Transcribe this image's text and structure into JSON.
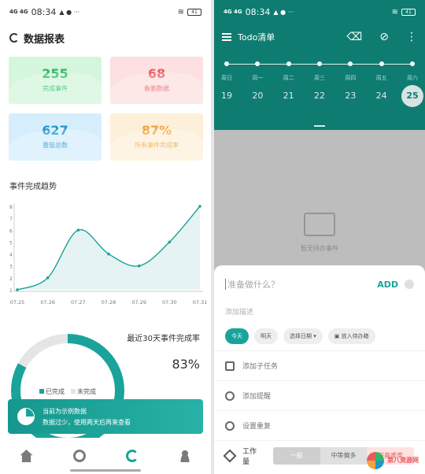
{
  "status_left": {
    "time": "08:34",
    "signal": "4G 4G",
    "extra": "▲ ● ···",
    "battery": "41"
  },
  "status_right": {
    "time": "08:34",
    "signal": "4G 4G",
    "extra": "▲ ● ···",
    "battery": "41"
  },
  "report": {
    "title": "数据报表",
    "stats": [
      {
        "value": "255",
        "label": "完成事件"
      },
      {
        "value": "68",
        "label": "备删数据"
      },
      {
        "value": "627",
        "label": "番茄总数"
      },
      {
        "value": "87%",
        "label": "所有事件完成率"
      }
    ],
    "trend_title": "事件完成趋势",
    "rate_title": "最近30天事件完成率",
    "rate_value": "83%",
    "legend": [
      "已完成",
      "未完成"
    ],
    "toast_line1": "当前为示例数据",
    "toast_line2": "数据过少，使用两天后再来查看"
  },
  "chart_data": {
    "type": "line",
    "categories": [
      "07.25",
      "07.26",
      "07.27",
      "07.28",
      "07.29",
      "07.30",
      "07.31"
    ],
    "values": [
      1,
      2,
      6,
      4,
      3,
      5,
      8
    ],
    "ylim": [
      1,
      8
    ],
    "yticks": [
      "1",
      "2",
      "3",
      "4",
      "5",
      "6",
      "7",
      "8"
    ],
    "color": "#1aa39a",
    "fill": "#e5f3f4",
    "grid": false
  },
  "nav": [
    "home-icon",
    "timer-icon",
    "stats-icon",
    "user-icon"
  ],
  "todo": {
    "title": "Todo清单",
    "weekdays": [
      "周日",
      "周一",
      "周二",
      "周三",
      "周四",
      "周五",
      "周六"
    ],
    "days": [
      "19",
      "20",
      "21",
      "22",
      "23",
      "24",
      "25"
    ],
    "selected_day": "25",
    "empty_text": "暂无待办事件",
    "input_placeholder": "准备做什么？",
    "add_label": "ADD",
    "desc_placeholder": "添加描述",
    "chips": [
      "今天",
      "明天",
      "选择日期",
      "放入待办箱"
    ],
    "options": [
      "添加子任务",
      "添加提醒",
      "设置重复"
    ],
    "workload_label": "工作量",
    "workload_options": [
      "一般",
      "中等偏多",
      "较高难度"
    ],
    "watermark": "第八资源网"
  },
  "colors": {
    "teal": "#0f7c71",
    "accent": "#1aa39a"
  }
}
